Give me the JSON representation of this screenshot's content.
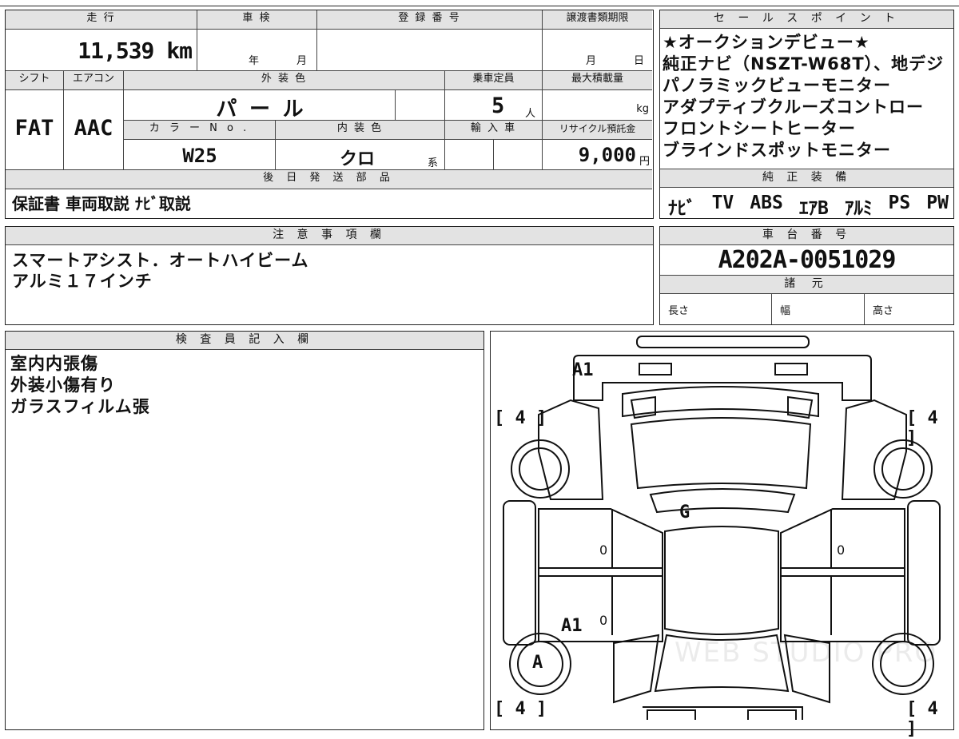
{
  "specs": {
    "mileage_label": "走 行",
    "mileage_value": "11,539",
    "mileage_unit": "km",
    "shaken_label": "車 検",
    "shaken_year": "年",
    "shaken_month": "月",
    "reg_label": "登 録 番 号",
    "transfer_label": "譲渡書類期限",
    "transfer_month": "月",
    "transfer_day": "日",
    "shift_label": "シフト",
    "shift_value": "FAT",
    "aircon_label": "エアコン",
    "aircon_value": "AAC",
    "color_label": "外 装 色",
    "color_value": "パ ー ル",
    "color_no_label": "カ ラ ー N o .",
    "color_no_value": "W25",
    "interior_label": "内 装 色",
    "interior_value": "クロ",
    "interior_suffix": "系",
    "capacity_label": "乗車定員",
    "capacity_value": "5",
    "capacity_unit": "人",
    "maxload_label": "最大積載量",
    "maxload_unit": "kg",
    "import_label": "輸 入 車",
    "recycle_label": "リサイクル預託金",
    "recycle_value": "9,000",
    "recycle_unit": "円",
    "later_label": "後 日 発 送 部 品",
    "later_value": "保証書 車両取説 ﾅﾋﾞ取説"
  },
  "sales": {
    "title": "セ ー ル ス ポ イ ン ト",
    "lines": [
      "★オークションデビュー★",
      "純正ナビ（NSZT-W68T）、地デジ",
      "パノラミックビューモニター",
      "アダプティブクルーズコントロー",
      "フロントシートヒーター",
      "ブラインドスポットモニター"
    ],
    "equip_title": "純 正 装 備",
    "equip_items": [
      "ﾅﾋﾞ",
      "TV",
      "ABS",
      "ｴｱB",
      "ｱﾙﾐ",
      "PS",
      "PW"
    ]
  },
  "notes": {
    "title": "注 意 事 項 欄",
    "lines": [
      "スマートアシスト．オートハイビーム",
      "アルミ１７インチ"
    ]
  },
  "chassis": {
    "title": "車 台 番 号",
    "value": "A202A-0051029",
    "dims_title": "諸 元",
    "length_label": "長さ",
    "width_label": "幅",
    "height_label": "高さ"
  },
  "inspector": {
    "title": "検 査 員 記 入 欄",
    "lines": [
      "室内内張傷",
      "外装小傷有り",
      "ガラスフィルム張"
    ]
  },
  "diagram": {
    "marks": {
      "front_bumper": "A1",
      "windshield": "G",
      "rear_door_left": "A1",
      "rear_wheel_left": "A",
      "left_door_front": "0",
      "left_door_rear": "0",
      "right_door_front": "0"
    },
    "tire_fl": "[ 4 ]",
    "tire_fr": "[ 4 ]",
    "tire_rl": "[ 4 ]",
    "tire_rr": "[ 4 ]",
    "watermark": "WEB STUDIO PRO"
  }
}
